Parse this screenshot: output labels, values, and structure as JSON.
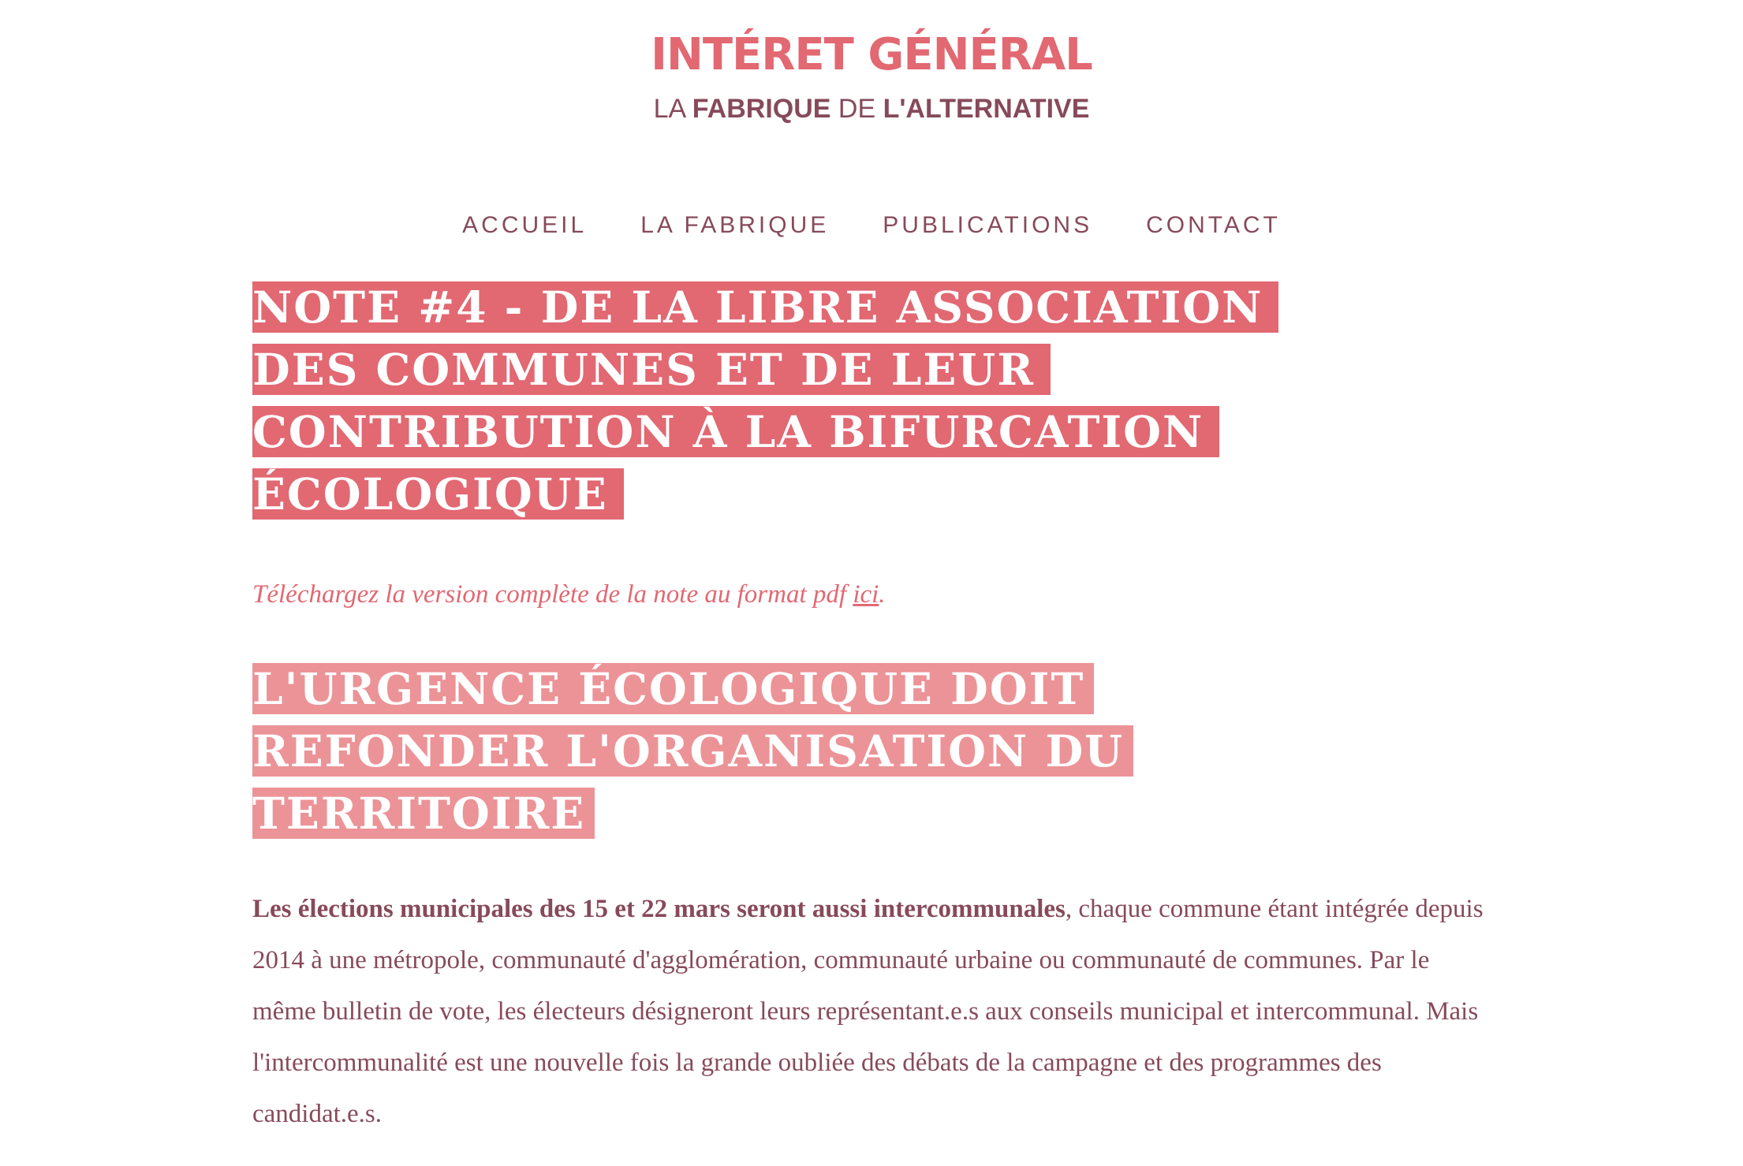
{
  "header": {
    "title": "INTÉRET GÉNÉRAL",
    "tagline_1": "LA ",
    "tagline_2": "FABRIQUE",
    "tagline_3": " DE ",
    "tagline_4": "L'ALTERNATIVE"
  },
  "nav": {
    "items": [
      {
        "label": "ACCUEIL"
      },
      {
        "label": "LA FABRIQUE"
      },
      {
        "label": "PUBLICATIONS"
      },
      {
        "label": "CONTACT"
      }
    ]
  },
  "article": {
    "title": " NOTE #4 - DE LA LIBRE ASSOCIATION DES COMMUNES ET DE LEUR CONTRIBUTION À LA BIFURCATION ÉCOLOGIQUE ",
    "download_prefix": "Téléchargez la version complète de la note au format pdf ",
    "download_link": "ici",
    "download_suffix": ".",
    "section_heading": " L'URGENCE ÉCOLOGIQUE DOIT REFONDER L'ORGANISATION DU TERRITOIRE ",
    "paragraph_bold": "Les élections municipales des 15 et 22 mars seront aussi intercommunales",
    "paragraph_rest": ", chaque commune étant intégrée depuis 2014 à une métropole, communauté d'agglomération, communauté urbaine ou communauté de communes. Par le même bulletin de vote, les électeurs désigneront leurs représentant.e.s aux conseils municipal et intercommunal. Mais l'intercommunalité est une nouvelle fois la grande oubliée des débats de la campagne et des programmes des candidat.e.s."
  },
  "colors": {
    "accent": "#e26872",
    "accent_light": "#ec9397",
    "text": "#874a5b",
    "background": "#ffffff"
  }
}
